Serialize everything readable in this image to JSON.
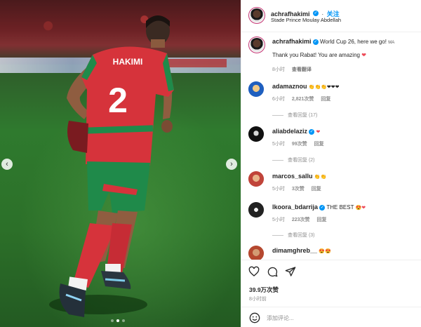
{
  "photo": {
    "player_name": "HAKIMI",
    "shirt_number": "2",
    "carousel_dots": 3,
    "active_dot": 1
  },
  "header": {
    "username": "achrafhakimi",
    "follow_label": "关注",
    "location": "Stade Prince Moulay Abdellah"
  },
  "caption": {
    "username": "achrafhakimi",
    "line1": "World Cup 26, here we go!",
    "flag": "MA",
    "line2": "Thank you Rabat! You are amazing",
    "time": "8小时",
    "translate": "查看翻译"
  },
  "comments": [
    {
      "username": "adamaznou",
      "emojis": "👏👏👏❤❤❤",
      "time": "6小时",
      "likes": "2,821次赞",
      "reply": "回复",
      "view_replies": "查看回复 (17)",
      "avatar_color": "#1f5fbf"
    },
    {
      "username": "aliabdelaziz",
      "emojis": "❤",
      "time": "5小时",
      "likes": "99次赞",
      "reply": "回复",
      "view_replies": "查看回复 (2)",
      "avatar_color": "#111111"
    },
    {
      "username": "marcos_sallu",
      "emojis": "👏👏",
      "time": "5小时",
      "likes": "3次赞",
      "reply": "回复",
      "view_replies": "",
      "avatar_color": "#c0443a"
    },
    {
      "username": "lkoora_bdarrija",
      "text": "THE BEST",
      "emojis": "😍❤",
      "time": "5小时",
      "likes": "223次赞",
      "reply": "回复",
      "view_replies": "查看回复 (3)",
      "avatar_color": "#222222"
    },
    {
      "username": "dimamghreb__",
      "emojis": "😍😍",
      "time": "",
      "likes": "",
      "reply": "",
      "view_replies": "",
      "avatar_color": "#b5482f"
    }
  ],
  "footer": {
    "likes": "39.9万次赞",
    "time": "8小时前",
    "add_comment_placeholder": "添加评论..."
  },
  "colors": {
    "accent_blue": "#0095f6",
    "heart_red": "#ed4956",
    "jersey_red": "#d6333b",
    "jersey_green": "#1f8a4a"
  }
}
